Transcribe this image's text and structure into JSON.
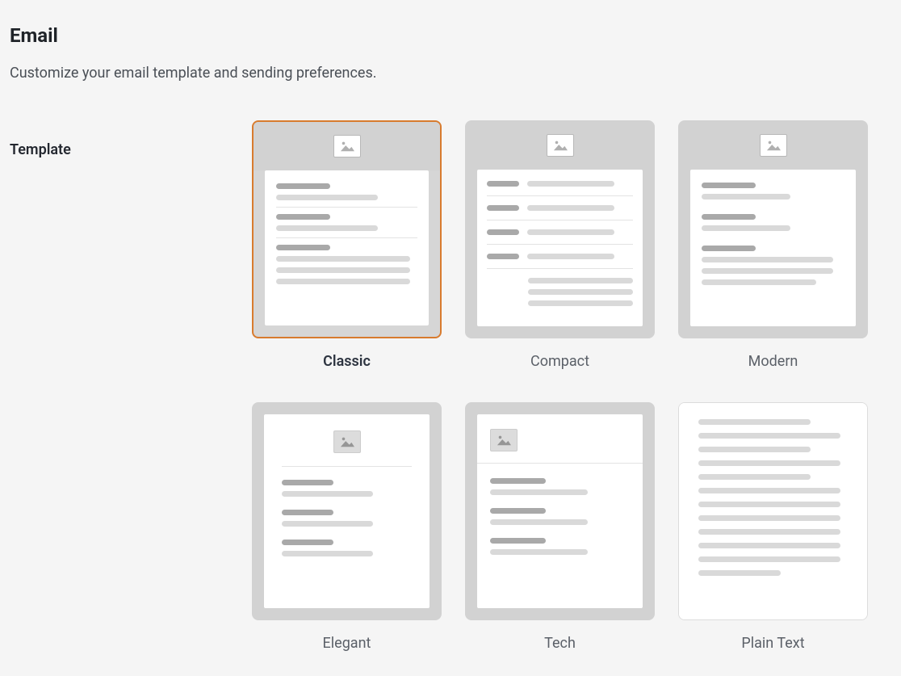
{
  "header": {
    "title": "Email",
    "subtitle": "Customize your email template and sending preferences."
  },
  "section": {
    "label": "Template"
  },
  "templates": [
    {
      "name": "Classic",
      "selected": true
    },
    {
      "name": "Compact",
      "selected": false
    },
    {
      "name": "Modern",
      "selected": false
    },
    {
      "name": "Elegant",
      "selected": false
    },
    {
      "name": "Tech",
      "selected": false
    },
    {
      "name": "Plain Text",
      "selected": false
    }
  ]
}
